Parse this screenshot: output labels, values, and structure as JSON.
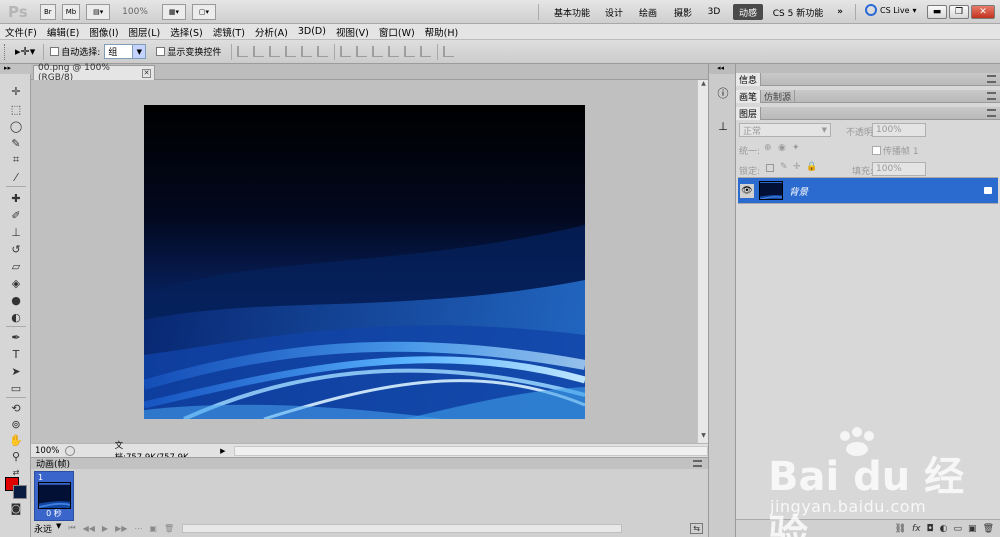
{
  "app": {
    "logo": "Ps",
    "bridge_label": "Br",
    "minibridge_label": "Mb",
    "zoom_label": "100%",
    "workspaces": [
      "基本功能",
      "设计",
      "绘画",
      "摄影",
      "3D",
      "动感",
      "CS 5 新功能"
    ],
    "active_workspace": "动感",
    "more_label": "»",
    "cslive_label": "CS Live"
  },
  "menu": [
    "文件(F)",
    "编辑(E)",
    "图像(I)",
    "图层(L)",
    "选择(S)",
    "滤镜(T)",
    "分析(A)",
    "3D(D)",
    "视图(V)",
    "窗口(W)",
    "帮助(H)"
  ],
  "options": {
    "auto_select_label": "自动选择:",
    "auto_select_value": "组",
    "show_transform_label": "显示变换控件"
  },
  "document": {
    "tab_title": "00.png @ 100%(RGB/8)",
    "zoom": "100%",
    "doc_info": "文档:757.9K/757.9K"
  },
  "animation": {
    "panel_title": "动画(帧)",
    "frame_number": "1",
    "frame_duration": "0 秒",
    "loop_value": "永远"
  },
  "panels": {
    "info_tab": "信息",
    "brush_tab": "画笔",
    "clone_tab": "仿制源",
    "layers_tab": "图层",
    "blend_mode": "正常",
    "opacity_label": "不透明度:",
    "opacity_value": "100%",
    "unify_label": "统一:",
    "propagate_label": "传播帧 1",
    "lock_label": "锁定:",
    "fill_label": "填充:",
    "fill_value": "100%",
    "layer_name": "背景"
  },
  "watermark": {
    "brand": "Bai du 经验",
    "url": "jingyan.baidu.com"
  }
}
